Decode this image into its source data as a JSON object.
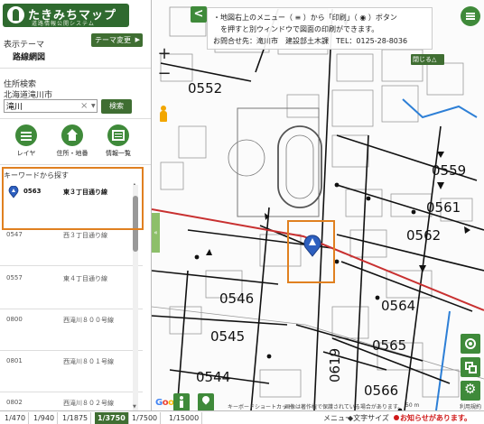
{
  "app": {
    "title": "たきみちマップ",
    "subtitle": "道路情報公開システム"
  },
  "theme": {
    "label": "表示テーマ",
    "change_button": "テーマ変更",
    "value": "路線網図"
  },
  "address_search": {
    "label": "住所検索",
    "prefecture": "北海道滝川市",
    "input_value": "滝川",
    "clear_icon": "×",
    "search_button": "検索"
  },
  "tools": [
    {
      "label": "レイヤ",
      "icon": "layers-icon"
    },
    {
      "label": "住所・地番",
      "icon": "home-icon"
    },
    {
      "label": "情報一覧",
      "icon": "list-icon"
    }
  ],
  "keyword_search": {
    "header": "キーワードから探す",
    "results": [
      {
        "code": "0563",
        "name": "東３丁目通り線",
        "selected": true
      },
      {
        "code": "0547",
        "name": "西３丁目通り線",
        "selected": false
      },
      {
        "code": "0557",
        "name": "東４丁目通り線",
        "selected": false
      },
      {
        "code": "0800",
        "name": "西滝川８００号線",
        "selected": false
      },
      {
        "code": "0801",
        "name": "西滝川８０１号線",
        "selected": false
      },
      {
        "code": "0802",
        "name": "西滝川８０２号線",
        "selected": false
      }
    ]
  },
  "map": {
    "message_lines": [
      "・地図右上のメニュー（ ≡ ）から「印刷」（ ◉ ）ボタン",
      "　を押すと別ウィンドウで図面の印刷ができます。",
      "お問合せ先：滝川市　建設部土木課　TEL：0125-28-8036"
    ],
    "close_button": "閉じる△",
    "zoom_in": "+",
    "zoom_out": "−",
    "back_arrow": "<",
    "road_labels": [
      "0552",
      "0559",
      "0561",
      "0562",
      "0546",
      "0564",
      "0545",
      "0565",
      "0544",
      "0619",
      "0566"
    ],
    "panel_toggle": "«",
    "footer": {
      "google": "Google",
      "keyboard_shortcuts": "キーボードショートカット",
      "copyright": "画像は著作権で保護されている場合があります。",
      "scale": "50 m",
      "terms": "利用規約"
    },
    "colors": {
      "primary_green": "#3f8a3a",
      "dark_green": "#3f6e32",
      "highlight_orange": "#e08020",
      "selected_road": "#c83030",
      "blue_road": "#2d7fd6"
    }
  },
  "scales": {
    "items": [
      "1/470",
      "1/940",
      "1/1875",
      "1/3750",
      "1/7500",
      "1/15000"
    ],
    "active": "1/3750"
  },
  "bottom_bar": {
    "menu": "メニュー",
    "text_size": "◆文字サイズ",
    "notice": "お知らせがあります。"
  }
}
